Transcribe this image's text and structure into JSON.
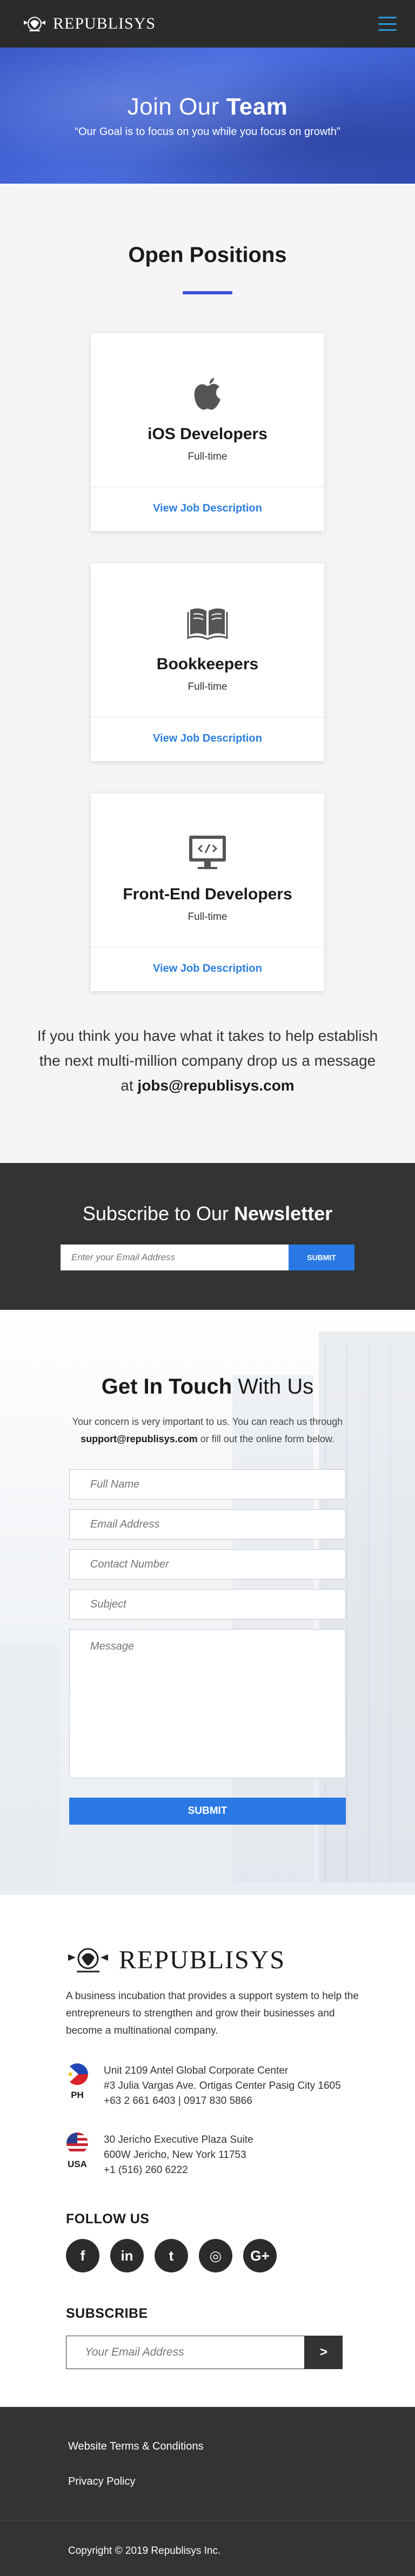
{
  "header": {
    "brand": "REPUBLISYS",
    "menu_icon": "hamburger-menu-icon",
    "menu_color": "#2b9bd8"
  },
  "hero": {
    "title_regular": "Join Our",
    "title_bold": "Team",
    "tagline": "“Our Goal is to focus on you while you focus on growth”",
    "bg_color": "#3a58c9"
  },
  "positions": {
    "title": "Open Positions",
    "accent": "#3f51d6",
    "jobs": [
      {
        "icon": "apple-icon",
        "title": "iOS Developers",
        "type": "Full-time",
        "link": "View Job Description"
      },
      {
        "icon": "book-icon",
        "title": "Bookkeepers",
        "type": "Full-time",
        "link": "View Job Description"
      },
      {
        "icon": "code-monitor-icon",
        "title": "Front-End Developers",
        "type": "Full-time",
        "link": "View Job Description"
      }
    ],
    "note_text": "If you think you have what it takes to help establish the next multi-million company drop us a message at",
    "note_email": "jobs@republisys.com"
  },
  "newsletter": {
    "title_regular": "Subscribe to Our",
    "title_bold": "Newsletter",
    "placeholder": "Enter your Email Address",
    "button": "SUBMIT"
  },
  "touch": {
    "title_bold": "Get In Touch",
    "title_regular": "With Us",
    "desc_before": "Your concern is very important to us. You can reach us through",
    "desc_email": "support@republisys.com",
    "desc_after": "or fill out the online form below.",
    "fields": {
      "name": "Full Name",
      "email": "Email Address",
      "phone": "Contact Number",
      "subject": "Subject",
      "message": "Message"
    },
    "button": "SUBMIT"
  },
  "company": {
    "brand": "REPUBLISYS",
    "description": "A business incubation that provides a support system to help the entrepreneurs to strengthen and grow their businesses and become a multinational company.",
    "offices": [
      {
        "code": "PH",
        "lines": [
          "Unit 2109 Antel Global Corporate Center",
          "#3 Julia Vargas Ave. Ortigas Center Pasig City 1605",
          "+63 2 661 6403 | 0917 830 5866"
        ]
      },
      {
        "code": "USA",
        "lines": [
          "30 Jericho Executive Plaza Suite",
          "600W Jericho, New York 11753",
          "+1 (516) 260 6222"
        ]
      }
    ],
    "follow_title": "FOLLOW US",
    "socials": [
      {
        "name": "facebook-icon",
        "glyph": "f"
      },
      {
        "name": "linkedin-icon",
        "glyph": "in"
      },
      {
        "name": "twitter-icon",
        "glyph": "t"
      },
      {
        "name": "instagram-icon",
        "glyph": "◎"
      },
      {
        "name": "google-plus-icon",
        "glyph": "G+"
      }
    ],
    "subscribe_title": "SUBSCRIBE",
    "subscribe_placeholder": "Your Email Address",
    "subscribe_button": ">"
  },
  "footer": {
    "links": [
      "Website Terms & Conditions",
      "Privacy Policy"
    ],
    "copyright": "Copyright © 2019 Republisys Inc."
  }
}
